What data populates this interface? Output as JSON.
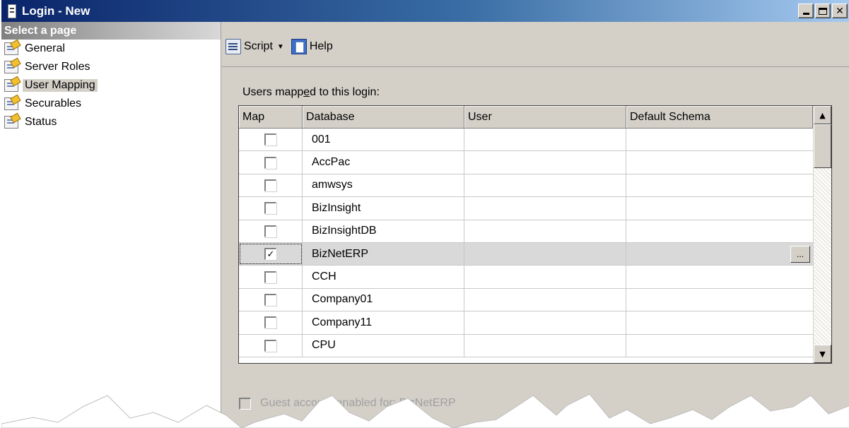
{
  "window": {
    "title": "Login - New",
    "controls": {
      "minimize": "_",
      "maximize": "□",
      "close": "✕"
    }
  },
  "sidebar": {
    "header": "Select a page",
    "items": [
      {
        "label": "General",
        "icon": "page-icon"
      },
      {
        "label": "Server Roles",
        "icon": "page-icon"
      },
      {
        "label": "User Mapping",
        "icon": "page-icon",
        "active": true
      },
      {
        "label": "Securables",
        "icon": "page-icon"
      },
      {
        "label": "Status",
        "icon": "page-icon"
      }
    ]
  },
  "toolbar": {
    "script_label": "Script",
    "script_arrow": "▼",
    "help_label": "Help"
  },
  "users_mapped": {
    "label_before": "Users mapp",
    "label_underline": "e",
    "label_after": "d to this login:"
  },
  "grid": {
    "columns": [
      "Map",
      "Database",
      "User",
      "Default Schema"
    ],
    "rows": [
      {
        "map": false,
        "database": "001",
        "user": "",
        "schema": ""
      },
      {
        "map": false,
        "database": "AccPac",
        "user": "",
        "schema": ""
      },
      {
        "map": false,
        "database": "amwsys",
        "user": "",
        "schema": ""
      },
      {
        "map": false,
        "database": "BizInsight",
        "user": "",
        "schema": ""
      },
      {
        "map": false,
        "database": "BizInsightDB",
        "user": "",
        "schema": ""
      },
      {
        "map": true,
        "database": "BizNetERP",
        "user": "",
        "schema": "",
        "selected": true,
        "schema_button": "..."
      },
      {
        "map": false,
        "database": "CCH",
        "user": "",
        "schema": ""
      },
      {
        "map": false,
        "database": "Company01",
        "user": "",
        "schema": ""
      },
      {
        "map": false,
        "database": "Company11",
        "user": "",
        "schema": ""
      },
      {
        "map": false,
        "database": "CPU",
        "user": "",
        "schema": ""
      }
    ],
    "scroll_up": "▲",
    "scroll_down": "▼"
  },
  "guest": {
    "label": "Guest account enabled for: BizNetERP",
    "checked": false
  },
  "colors": {
    "title_bar": "#0a246a",
    "dialog_face": "#d4d0c8",
    "selected_row": "#d9d9d9",
    "disabled_text": "#a0a0a0"
  }
}
